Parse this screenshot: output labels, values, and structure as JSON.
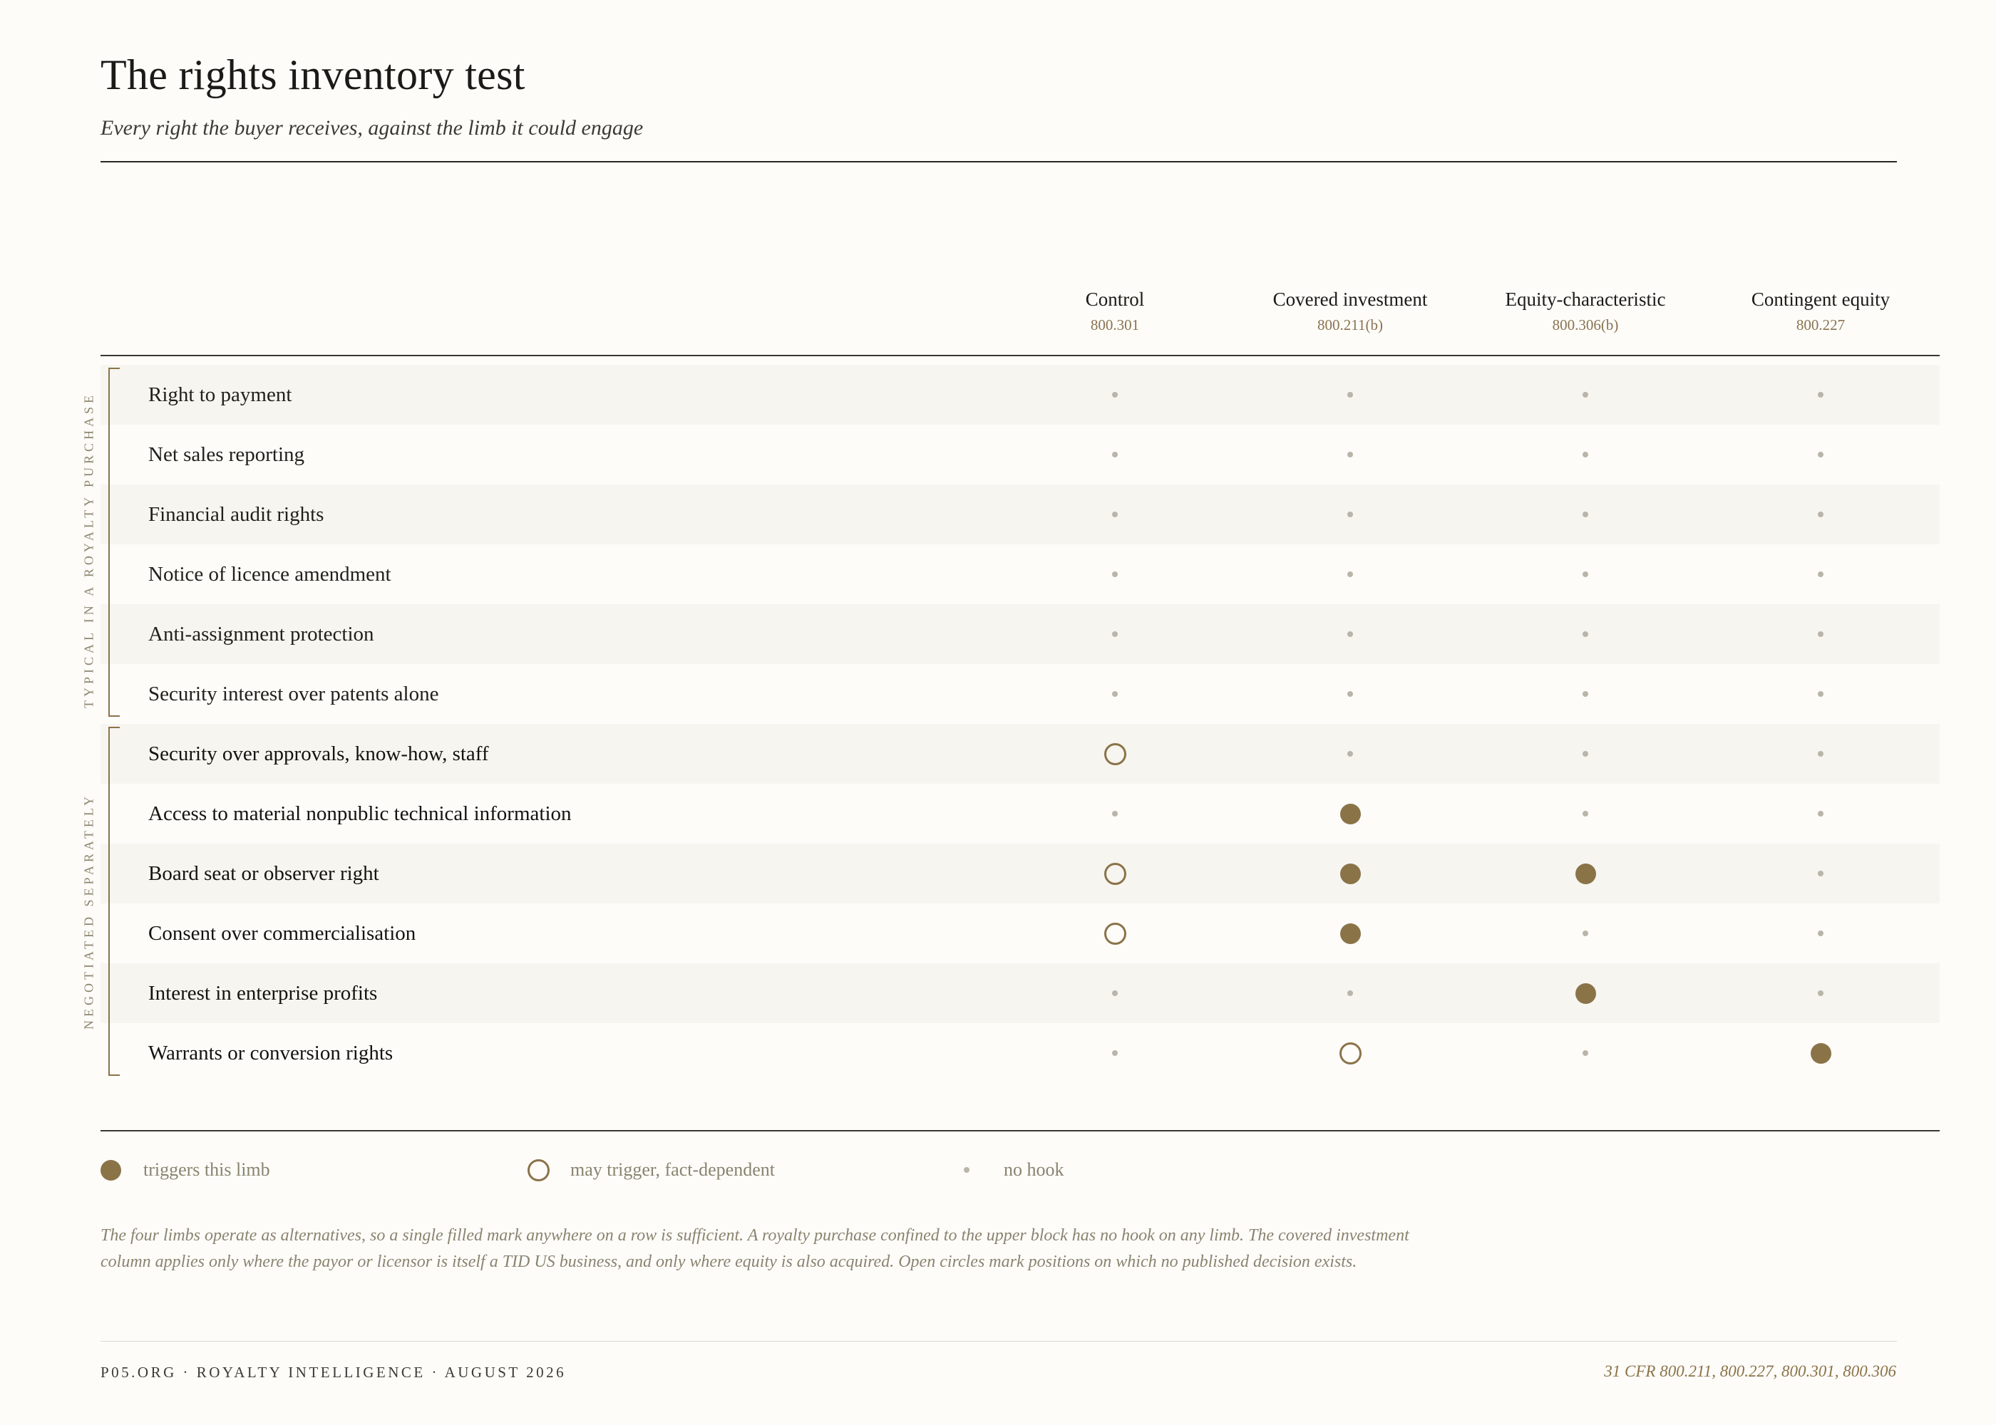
{
  "header": {
    "title": "The rights inventory test",
    "subtitle": "Every right the buyer receives, against the limb it could engage"
  },
  "columns": [
    {
      "name": "Control",
      "cite": "800.301"
    },
    {
      "name": "Covered investment",
      "cite": "800.211(b)"
    },
    {
      "name": "Equity-characteristic",
      "cite": "800.306(b)"
    },
    {
      "name": "Contingent equity",
      "cite": "800.227"
    }
  ],
  "groups": [
    {
      "label": "TYPICAL IN A ROYALTY PURCHASE"
    },
    {
      "label": "NEGOTIATED SEPARATELY"
    }
  ],
  "rows": [
    {
      "label": "Right to payment",
      "group": 0,
      "marks": [
        "none",
        "none",
        "none",
        "none"
      ]
    },
    {
      "label": "Net sales reporting",
      "group": 0,
      "marks": [
        "none",
        "none",
        "none",
        "none"
      ]
    },
    {
      "label": "Financial audit rights",
      "group": 0,
      "marks": [
        "none",
        "none",
        "none",
        "none"
      ]
    },
    {
      "label": "Notice of licence amendment",
      "group": 0,
      "marks": [
        "none",
        "none",
        "none",
        "none"
      ]
    },
    {
      "label": "Anti-assignment protection",
      "group": 0,
      "marks": [
        "none",
        "none",
        "none",
        "none"
      ]
    },
    {
      "label": "Security interest over patents alone",
      "group": 0,
      "marks": [
        "none",
        "none",
        "none",
        "none"
      ]
    },
    {
      "label": "Security over approvals, know-how, staff",
      "group": 1,
      "marks": [
        "open",
        "none",
        "none",
        "none"
      ]
    },
    {
      "label": "Access to material nonpublic technical information",
      "group": 1,
      "marks": [
        "none",
        "full",
        "none",
        "none"
      ]
    },
    {
      "label": "Board seat or observer right",
      "group": 1,
      "marks": [
        "open",
        "full",
        "full",
        "none"
      ]
    },
    {
      "label": "Consent over commercialisation",
      "group": 1,
      "marks": [
        "open",
        "full",
        "none",
        "none"
      ]
    },
    {
      "label": "Interest in enterprise profits",
      "group": 1,
      "marks": [
        "none",
        "none",
        "full",
        "none"
      ]
    },
    {
      "label": "Warrants or conversion rights",
      "group": 1,
      "marks": [
        "none",
        "open",
        "none",
        "full"
      ]
    }
  ],
  "legend": {
    "full": "triggers this limb",
    "open": "may trigger, fact-dependent",
    "none": "no hook"
  },
  "note": "The four limbs operate as alternatives, so a single filled mark anywhere on a row is sufficient. A royalty purchase confined to the upper block has no hook on any limb. The covered investment column applies only where the payor or licensor is itself a TID US business, and only where equity is also acquired. Open circles mark positions on which no published decision exists.",
  "footer": {
    "left": "P05.ORG · ROYALTY INTELLIGENCE · AUGUST 2026",
    "right": "31 CFR 800.211, 800.227, 800.301, 800.306"
  },
  "colors": {
    "accent": "#8b7348",
    "no_hook": "#b9b5ab",
    "shaded_row": "#f6f5f0"
  }
}
